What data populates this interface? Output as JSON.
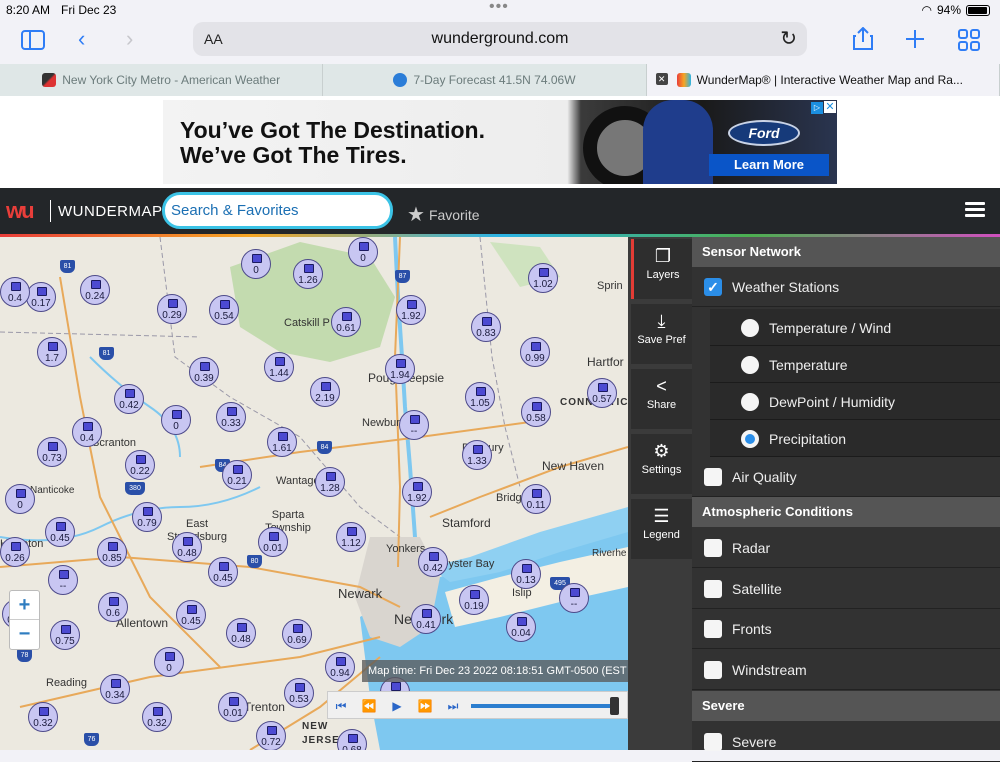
{
  "status": {
    "time": "8:20 AM",
    "date": "Fri Dec 23",
    "battery": "94%"
  },
  "toolbar": {
    "text_size": "AA",
    "url": "wunderground.com"
  },
  "tabs": [
    {
      "label": "New York City Metro - American Weather",
      "active": false
    },
    {
      "label": "7-Day Forecast 41.5N 74.06W",
      "active": false
    },
    {
      "label": "WunderMap® | Interactive Weather Map and Ra...",
      "active": true
    }
  ],
  "ad": {
    "headline": "You’ve Got The Destination.\nWe’ve Got The Tires.",
    "brand": "Ford",
    "cta": "Learn More"
  },
  "header": {
    "logo_mark": "wu",
    "logo_text": "WUNDERMAP",
    "search_placeholder": "Search & Favorites",
    "favorite_label": "Favorite"
  },
  "map": {
    "zoom_in": "+",
    "zoom_out": "−",
    "map_time": "Map time: Fri Dec 23 2022 08:18:51 GMT-0500 (EST",
    "stations": [
      "0",
      "0.17",
      "0.24",
      "1.26",
      "0",
      "1.02",
      "0.29",
      "0.54",
      "1.92",
      "0.61",
      "0.83",
      "0.4",
      "1.7",
      "0.39",
      "1.44",
      "1.94",
      "0.99",
      "0.42",
      "2.19",
      "1.05",
      "0.58",
      "0.57",
      "0.4",
      "0",
      "0.33",
      "1.61",
      "--",
      "1.33",
      "0.73",
      "0.22",
      "0.21",
      "1.28",
      "1.92",
      "0.11",
      "0",
      "0.79",
      "0.45",
      "0.48",
      "0.01",
      "1.12",
      "0.85",
      "0.45",
      "0.42",
      "0.13",
      "--",
      "--",
      "0.6",
      "0.45",
      "0.19",
      "0.77",
      "0.75",
      "0.48",
      "0.69",
      "0.41",
      "0.04",
      "0",
      "0.94",
      "0.34",
      "0.53",
      "0.32",
      "0.32",
      "0.01",
      "0.72",
      "0.68",
      "0.26",
      "0.55"
    ],
    "places": [
      "Catskill P",
      "Poughkeepsie",
      "Hartfor",
      "CONNECTICUT",
      "Scranton",
      "Newburgh",
      "Danbury",
      "New Haven",
      "Wantage",
      "Bridgeport",
      "Nanticoke",
      "East Stroudsburg",
      "Sparta Township",
      "Stamford",
      "Hazleton",
      "Yonkers",
      "Oyster Bay",
      "Riverhe",
      "Newark",
      "Islip",
      "New York",
      "Allentown",
      "Reading",
      "Trenton",
      "NEW JERSEY",
      "Sprin"
    ],
    "highways": [
      "81",
      "87",
      "81",
      "84",
      "84",
      "380",
      "80",
      "78",
      "495",
      "76"
    ]
  },
  "tools": [
    {
      "label": "Layers",
      "icon": "layers-icon"
    },
    {
      "label": "Save Pref",
      "icon": "download-icon"
    },
    {
      "label": "Share",
      "icon": "share-icon"
    },
    {
      "label": "Settings",
      "icon": "gear-icon"
    },
    {
      "label": "Legend",
      "icon": "list-icon"
    }
  ],
  "panel": {
    "sensor_network": "Sensor Network",
    "weather_stations": "Weather Stations",
    "options": [
      "Temperature / Wind",
      "Temperature",
      "DewPoint / Humidity",
      "Precipitation"
    ],
    "selected_option": "Precipitation",
    "air_quality": "Air Quality",
    "atmospheric": "Atmospheric Conditions",
    "atmo_items": [
      "Radar",
      "Satellite",
      "Fronts",
      "Windstream"
    ],
    "severe_header": "Severe",
    "severe_item": "Severe"
  },
  "colors": {
    "accent": "#2b8ee8",
    "wu_dark": "#232629",
    "search_border": "#3bc3e6",
    "water": "#7ec8f0",
    "station_fill": "#c8c6f2"
  }
}
